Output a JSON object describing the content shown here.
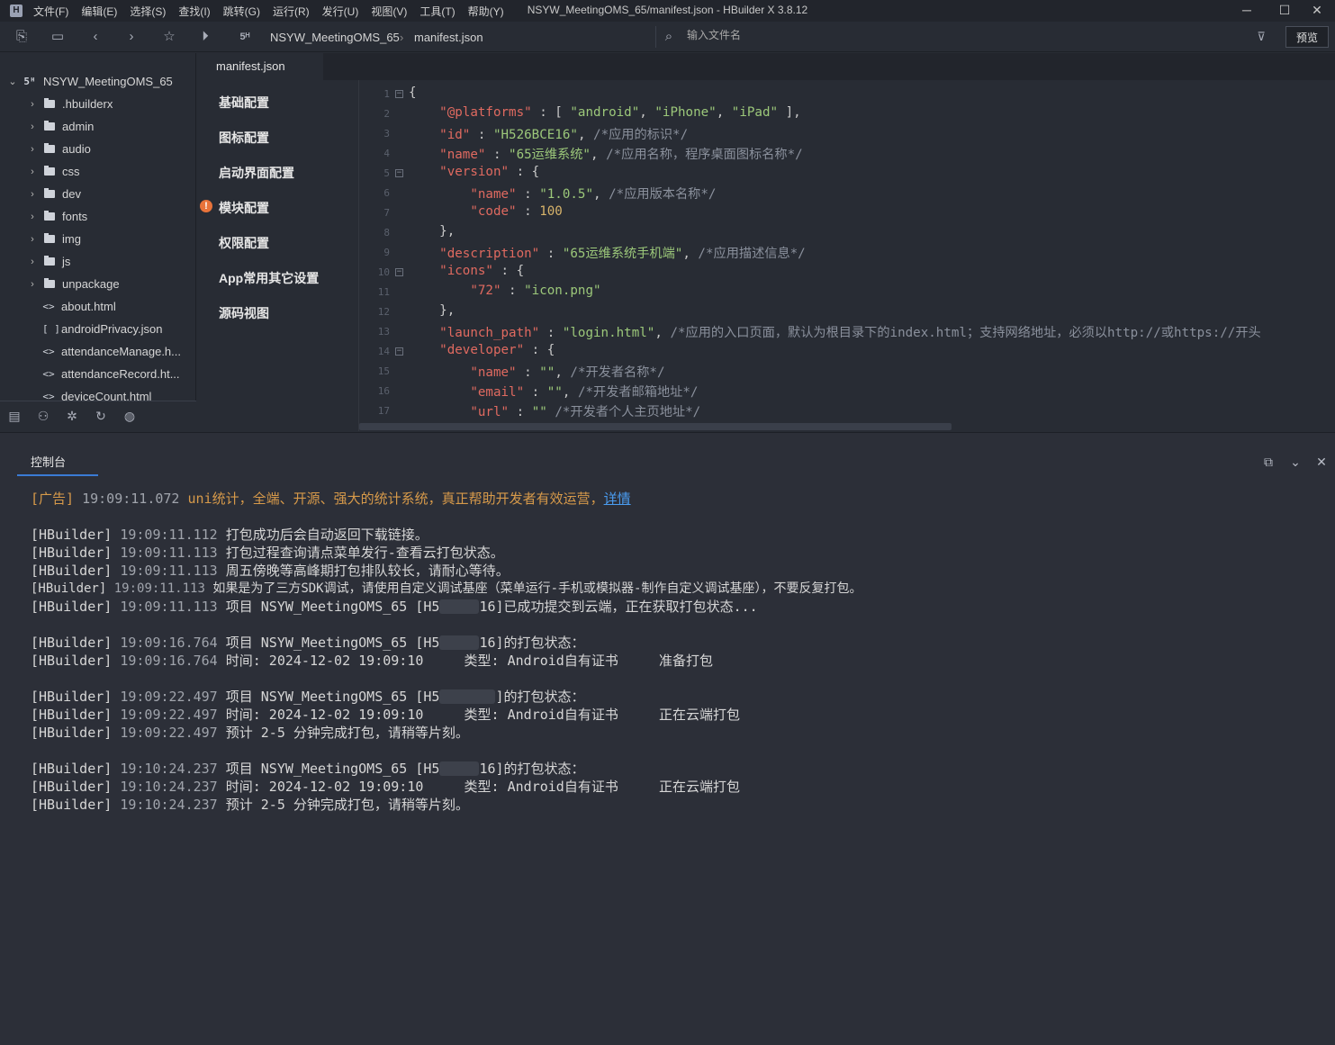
{
  "app": {
    "logo": "H",
    "window_title": "NSYW_MeetingOMS_65/manifest.json - HBuilder X 3.8.12",
    "menu": [
      "文件(F)",
      "编辑(E)",
      "选择(S)",
      "查找(I)",
      "跳转(G)",
      "运行(R)",
      "发行(U)",
      "视图(V)",
      "工具(T)",
      "帮助(Y)"
    ]
  },
  "toolbar": {
    "breadcrumb": [
      "NSYW_MeetingOMS_65",
      "manifest.json"
    ],
    "file_search_placeholder": "输入文件名",
    "preview_label": "预览"
  },
  "sidebar": {
    "project": "NSYW_MeetingOMS_65",
    "items": [
      {
        "label": ".hbuilderx",
        "type": "folder"
      },
      {
        "label": "admin",
        "type": "folder"
      },
      {
        "label": "audio",
        "type": "folder"
      },
      {
        "label": "css",
        "type": "folder"
      },
      {
        "label": "dev",
        "type": "folder"
      },
      {
        "label": "fonts",
        "type": "folder"
      },
      {
        "label": "img",
        "type": "folder"
      },
      {
        "label": "js",
        "type": "folder"
      },
      {
        "label": "unpackage",
        "type": "folder"
      },
      {
        "label": "about.html",
        "type": "html"
      },
      {
        "label": "androidPrivacy.json",
        "type": "json"
      },
      {
        "label": "attendanceManage.h...",
        "type": "html"
      },
      {
        "label": "attendanceRecord.ht...",
        "type": "html"
      },
      {
        "label": "deviceCount.html",
        "type": "html"
      }
    ]
  },
  "editor": {
    "tab": "manifest.json",
    "nav": [
      "基础配置",
      "图标配置",
      "启动界面配置",
      "模块配置",
      "权限配置",
      "App常用其它设置",
      "源码视图"
    ],
    "warn_icon": "!",
    "code": {
      "l1": "{",
      "l2": [
        "\"@platforms\"",
        " : [ ",
        "\"android\"",
        ", ",
        "\"iPhone\"",
        ", ",
        "\"iPad\"",
        " ],"
      ],
      "l3": [
        "\"id\"",
        " : ",
        "\"H526BCE16\"",
        ", ",
        "/*应用的标识*/"
      ],
      "l4": [
        "\"name\"",
        " : ",
        "\"65运维系统\"",
        ", ",
        "/*应用名称，程序桌面图标名称*/"
      ],
      "l5": [
        "\"version\"",
        " : {"
      ],
      "l6": [
        "\"name\"",
        " : ",
        "\"1.0.5\"",
        ", ",
        "/*应用版本名称*/"
      ],
      "l7": [
        "\"code\"",
        " : ",
        "100"
      ],
      "l8": "},",
      "l9": [
        "\"description\"",
        " : ",
        "\"65运维系统手机端\"",
        ", ",
        "/*应用描述信息*/"
      ],
      "l10": [
        "\"icons\"",
        " : {"
      ],
      "l11": [
        "\"72\"",
        " : ",
        "\"icon.png\""
      ],
      "l12": "},",
      "l13": [
        "\"launch_path\"",
        " : ",
        "\"login.html\"",
        ", ",
        "/*应用的入口页面，默认为根目录下的index.html；支持网络地址，必须以http://或https://开头"
      ],
      "l14": [
        "\"developer\"",
        " : {"
      ],
      "l15": [
        "\"name\"",
        " : ",
        "\"\"",
        ", ",
        "/*开发者名称*/"
      ],
      "l16": [
        "\"email\"",
        " : ",
        "\"\"",
        ", ",
        "/*开发者邮箱地址*/"
      ],
      "l17": [
        "\"url\"",
        " : ",
        "\"\"",
        " ",
        "/*开发者个人主页地址*/"
      ]
    }
  },
  "console": {
    "tab": "控制台",
    "ad": {
      "tag": "[广告]",
      "time": "19:09:11.072",
      "text": "uni统计，全端、开源、强大的统计系统，真正帮助开发者有效运营，",
      "link": "详情"
    },
    "logs": [
      {
        "tag": "[HBuilder]",
        "time": "19:09:11.112",
        "text": "打包成功后会自动返回下载链接。"
      },
      {
        "tag": "[HBuilder]",
        "time": "19:09:11.113",
        "text": "打包过程查询请点菜单发行-查看云打包状态。"
      },
      {
        "tag": "[HBuilder]",
        "time": "19:09:11.113",
        "text": "周五傍晚等高峰期打包排队较长，请耐心等待。"
      },
      {
        "tag": "[HBuilder]",
        "time": "19:09:11.113",
        "text": "如果是为了三方SDK调试，请使用自定义调试基座（菜单运行-手机或模拟器-制作自定义调试基座），不要反复打包。"
      },
      {
        "tag": "[HBuilder]",
        "time": "19:09:11.113",
        "text_a": "项目 NSYW_MeetingOMS_65 [H5",
        "text_b": "16]已成功提交到云端，正在获取打包状态..."
      },
      {
        "tag": "[HBuilder]",
        "time": "19:09:16.764",
        "text_a": "项目 NSYW_MeetingOMS_65 [H5",
        "text_b": "16]的打包状态："
      },
      {
        "tag": "[HBuilder]",
        "time": "19:09:16.764",
        "text": "时间: 2024-12-02 19:09:10     类型: Android自有证书     准备打包"
      },
      {
        "tag": "[HBuilder]",
        "time": "19:09:22.497",
        "text_a": "项目 NSYW_MeetingOMS_65 [H5",
        "text_b": "]的打包状态："
      },
      {
        "tag": "[HBuilder]",
        "time": "19:09:22.497",
        "text": "时间: 2024-12-02 19:09:10     类型: Android自有证书     正在云端打包"
      },
      {
        "tag": "[HBuilder]",
        "time": "19:09:22.497",
        "text": "预计 2-5 分钟完成打包，请稍等片刻。"
      },
      {
        "tag": "[HBuilder]",
        "time": "19:10:24.237",
        "text_a": "项目 NSYW_MeetingOMS_65 [H5",
        "text_b": "16]的打包状态："
      },
      {
        "tag": "[HBuilder]",
        "time": "19:10:24.237",
        "text": "时间: 2024-12-02 19:09:10     类型: Android自有证书     正在云端打包"
      },
      {
        "tag": "[HBuilder]",
        "time": "19:10:24.237",
        "text": "预计 2-5 分钟完成打包，请稍等片刻。"
      }
    ]
  },
  "colors": {
    "background": "#282c34",
    "console_bg": "#2c2f38",
    "key": "#e06a60",
    "string": "#9cc87a",
    "number": "#d7b36a",
    "comment": "#8a909c",
    "link": "#4a9cf0",
    "ad": "#d79a4a",
    "warn": "#e8733a"
  }
}
